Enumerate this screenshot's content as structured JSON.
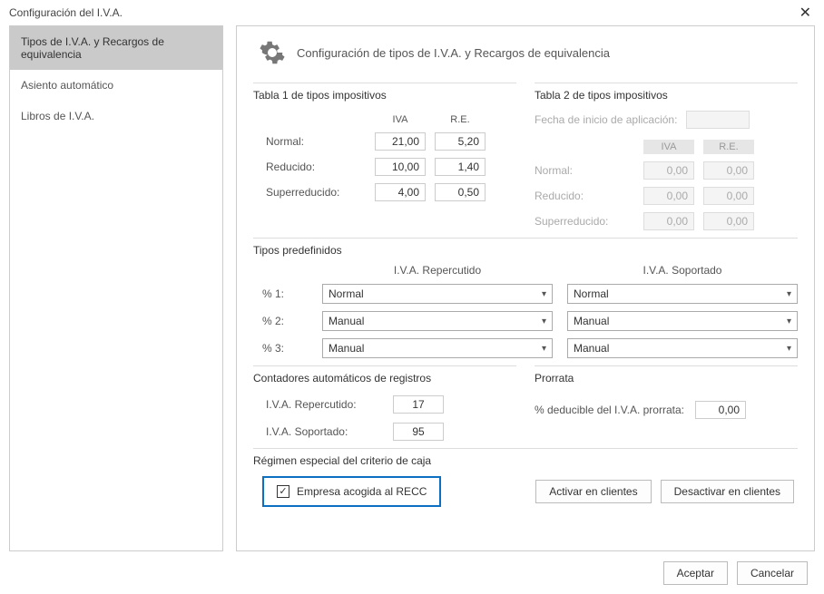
{
  "window": {
    "title": "Configuración del I.V.A."
  },
  "sidebar": {
    "items": [
      {
        "label": "Tipos de I.V.A. y Recargos de equivalencia",
        "selected": true
      },
      {
        "label": "Asiento automático",
        "selected": false
      },
      {
        "label": "Libros de I.V.A.",
        "selected": false
      }
    ]
  },
  "main": {
    "title": "Configuración de tipos de I.V.A. y Recargos de equivalencia",
    "tabla1": {
      "title": "Tabla 1 de tipos impositivos",
      "col_iva": "IVA",
      "col_re": "R.E.",
      "rows": {
        "normal_label": "Normal:",
        "normal_iva": "21,00",
        "normal_re": "5,20",
        "reducido_label": "Reducido:",
        "reducido_iva": "10,00",
        "reducido_re": "1,40",
        "super_label": "Superreducido:",
        "super_iva": "4,00",
        "super_re": "0,50"
      }
    },
    "tabla2": {
      "title": "Tabla 2 de tipos impositivos",
      "date_label": "Fecha de inicio de aplicación:",
      "col_iva": "IVA",
      "col_re": "R.E.",
      "rows": {
        "normal_label": "Normal:",
        "normal_iva": "0,00",
        "normal_re": "0,00",
        "reducido_label": "Reducido:",
        "reducido_iva": "0,00",
        "reducido_re": "0,00",
        "super_label": "Superreducido:",
        "super_iva": "0,00",
        "super_re": "0,00"
      }
    },
    "predefinidos": {
      "title": "Tipos predefinidos",
      "head_repercutido": "I.V.A. Repercutido",
      "head_soportado": "I.V.A. Soportado",
      "rows": [
        {
          "label": "% 1:",
          "repercutido": "Normal",
          "soportado": "Normal"
        },
        {
          "label": "% 2:",
          "repercutido": "Manual",
          "soportado": "Manual"
        },
        {
          "label": "% 3:",
          "repercutido": "Manual",
          "soportado": "Manual"
        }
      ]
    },
    "contadores": {
      "title": "Contadores automáticos de registros",
      "repercutido_label": "I.V.A. Repercutido:",
      "repercutido_val": "17",
      "soportado_label": "I.V.A. Soportado:",
      "soportado_val": "95"
    },
    "prorrata": {
      "title": "Prorrata",
      "label": "% deducible del I.V.A. prorrata:",
      "value": "0,00"
    },
    "recc": {
      "title": "Régimen especial del criterio de caja",
      "check_label": "Empresa acogida al RECC",
      "checked": true,
      "activar": "Activar en clientes",
      "desactivar": "Desactivar en clientes"
    }
  },
  "footer": {
    "accept": "Aceptar",
    "cancel": "Cancelar"
  }
}
